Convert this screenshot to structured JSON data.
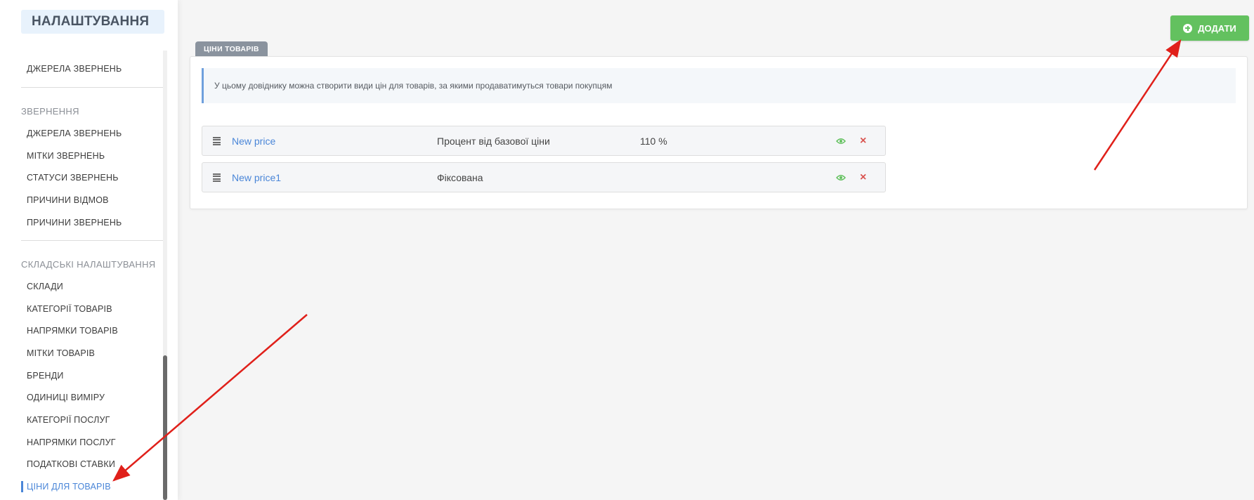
{
  "sidebar": {
    "title": "НАЛАШТУВАННЯ",
    "top_item": "ДЖЕРЕЛА ЗВЕРНЕНЬ",
    "sections": [
      {
        "title": "ЗВЕРНЕННЯ",
        "items": [
          "ДЖЕРЕЛА ЗВЕРНЕНЬ",
          "МІТКИ ЗВЕРНЕНЬ",
          "СТАТУСИ ЗВЕРНЕНЬ",
          "ПРИЧИНИ ВІДМОВ",
          "ПРИЧИНИ ЗВЕРНЕНЬ"
        ]
      },
      {
        "title": "СКЛАДСЬКІ НАЛАШТУВАННЯ",
        "items": [
          "СКЛАДИ",
          "КАТЕГОРІЇ ТОВАРІВ",
          "НАПРЯМКИ ТОВАРІВ",
          "МІТКИ ТОВАРІВ",
          "БРЕНДИ",
          "ОДИНИЦІ ВИМІРУ",
          "КАТЕГОРІЇ ПОСЛУГ",
          "НАПРЯМКИ ПОСЛУГ",
          "ПОДАТКОВІ СТАВКИ",
          "ЦІНИ ДЛЯ ТОВАРІВ"
        ]
      }
    ],
    "active_item": "ЦІНИ ДЛЯ ТОВАРІВ"
  },
  "header": {
    "add_label": "ДОДАТИ",
    "tab_label": "ЦІНИ ТОВАРІВ"
  },
  "info_text": "У цьому довіднику можна створити види цін для товарів, за якими продаватимуться товари покупцям",
  "prices": [
    {
      "name": "New price",
      "type": "Процент від базової ціни",
      "value": "110 %"
    },
    {
      "name": "New price1",
      "type": "Фіксована",
      "value": ""
    }
  ],
  "colors": {
    "accent": "#4a86d8",
    "success": "#63c15f",
    "danger": "#d9534f",
    "annotation": "#e0201a"
  }
}
